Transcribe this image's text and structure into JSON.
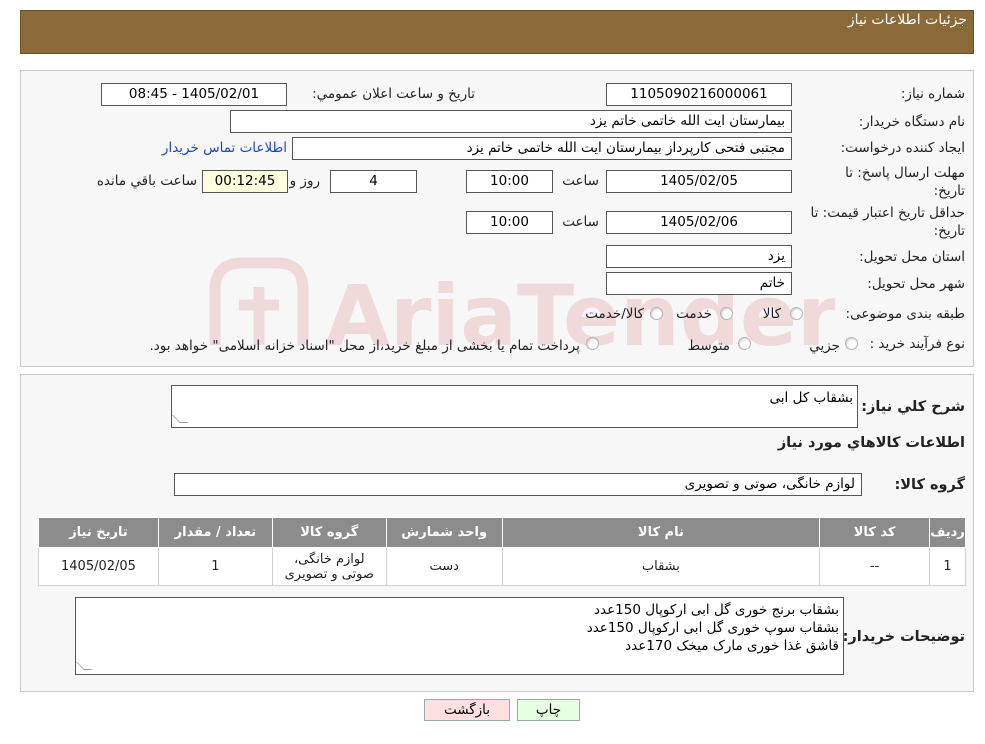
{
  "header": {
    "title": "جزئیات اطلاعات نیاز"
  },
  "form": {
    "need_number": {
      "label": "شماره نیاز:",
      "value": "1105090216000061"
    },
    "announce_datetime": {
      "label": "تاريخ و ساعت اعلان عمومي:",
      "value": "1405/02/01 - 08:45"
    },
    "buyer_org": {
      "label": "نام دستگاه خريدار:",
      "value": "بیمارستان ایت الله خاتمی خاتم یزد"
    },
    "requester": {
      "label": "ايجاد کننده درخواست:",
      "value": "مجتبی فتحی کارپرداز بیمارستان ایت الله خاتمی خاتم یزد",
      "contact_link": "اطلاعات تماس خريدار"
    },
    "reply_deadline": {
      "label_line1": "مهلت ارسال پاسخ: تا",
      "label_line2": "تاریخ:",
      "date": "1405/02/05",
      "time_label": "ساعت",
      "time": "10:00",
      "days": "4",
      "days_label": "روز و",
      "remaining": "00:12:45",
      "remaining_label": "ساعت باقي مانده"
    },
    "price_validity": {
      "label_line1": "حداقل تاريخ اعتبار قيمت: تا",
      "label_line2": "تاريخ:",
      "date": "1405/02/06",
      "time_label": "ساعت",
      "time": "10:00"
    },
    "province": {
      "label": "استان محل تحويل:",
      "value": "یزد"
    },
    "city": {
      "label": "شهر محل تحويل:",
      "value": "خاتم"
    },
    "category": {
      "label": "طبقه بندی موضوعی:",
      "options": [
        "کالا",
        "خدمت",
        "کالا/خدمت"
      ]
    },
    "process": {
      "label": "نوع فرآيند خريد :",
      "options": [
        "جزيي",
        "متوسط"
      ],
      "note": "پرداخت تمام يا بخشی از مبلغ خريد،از محل \"اسناد خزانه اسلامی\" خواهد بود."
    }
  },
  "description": {
    "label": "شرح كلي نياز:",
    "value": "بشقاب کل ابی"
  },
  "goods_info_title": "اطلاعات كالاهاي مورد نياز",
  "goods_group": {
    "label": "گروه كالا:",
    "value": "لوازم خانگی، صوتی و تصویری"
  },
  "table": {
    "headers": [
      "رديف",
      "كد كالا",
      "نام كالا",
      "واحد شمارش",
      "گروه كالا",
      "تعداد / مقدار",
      "تاريخ نياز"
    ],
    "rows": [
      {
        "index": "1",
        "code": "--",
        "name": "بشقاب",
        "unit": "دست",
        "group_line1": "لوازم خانگی،",
        "group_line2": "صوتی و تصویری",
        "qty": "1",
        "date": "1405/02/05"
      }
    ]
  },
  "buyer_notes": {
    "label": "توضيحات خريدار:",
    "lines": [
      "بشقاب برنج خوری گل ابی ارکوپال 150عدد",
      "بشقاب سوپ خوری گل ابی ارکوپال 150عدد",
      "قاشق غذا خوری مارک میخک 170عدد"
    ]
  },
  "buttons": {
    "print": "چاپ",
    "back": "بازگشت"
  },
  "watermark": {
    "text": "AriaTender.neT"
  },
  "colors": {
    "header_bg": "#8b6a3a",
    "table_header_bg": "#8c8c8c",
    "link": "#1a47c7",
    "print_btn_bg": "#e6ffe0",
    "back_btn_bg": "#ffe0e0"
  }
}
